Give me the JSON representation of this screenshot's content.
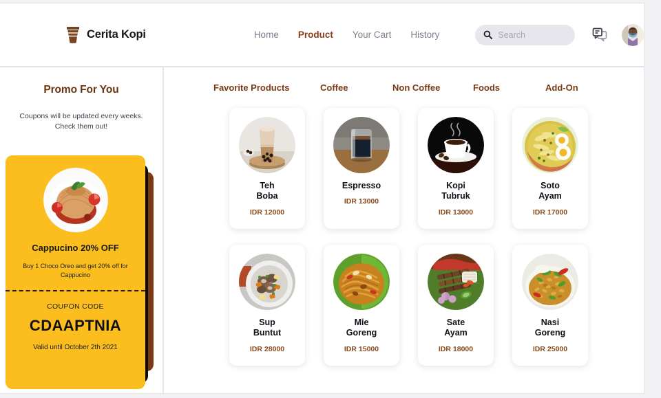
{
  "brand": {
    "name": "Cerita Kopi",
    "logo_icon": "coffee-cup-icon",
    "logo_color": "#7b4420"
  },
  "nav": {
    "items": [
      {
        "label": "Home",
        "active": false
      },
      {
        "label": "Product",
        "active": true
      },
      {
        "label": "Your Cart",
        "active": false
      },
      {
        "label": "History",
        "active": false
      }
    ],
    "active_color": "#8a3c16",
    "inactive_color": "#7d7f8c"
  },
  "search": {
    "placeholder": "Search",
    "value": "",
    "icon": "search-icon"
  },
  "header_actions": {
    "chat_icon": "chat-bubbles-icon",
    "avatar_icon": "user-avatar"
  },
  "sidebar": {
    "title": "Promo For You",
    "subtitle": "Coupons will be updated every weeks.\nCheck them out!",
    "coupon": {
      "photo_icon": "pasta-photo",
      "heading": "Cappucino\n20% OFF",
      "description": "Buy 1 Choco Oreo and get 20%\noff for Cappucino",
      "code_label": "COUPON CODE",
      "code": "CDAAPTNIA",
      "valid": "Valid until October 2th 2021",
      "bg_color": "#fbbe1e",
      "stack_colors": [
        "#0b0b0b",
        "#7c3a12"
      ]
    }
  },
  "categories": {
    "items": [
      {
        "label": "Favorite Products",
        "active": true
      },
      {
        "label": "Coffee",
        "active": false
      },
      {
        "label": "Non Coffee",
        "active": false
      },
      {
        "label": "Foods",
        "active": false
      },
      {
        "label": "Add-On",
        "active": false
      }
    ],
    "color": "#7b3a15"
  },
  "products": [
    {
      "name": "Teh\nBoba",
      "price": "IDR 12000",
      "photo": "teh-boba-photo"
    },
    {
      "name": "Espresso",
      "price": "IDR 13000",
      "photo": "espresso-photo"
    },
    {
      "name": "Kopi\nTubruk",
      "price": "IDR 13000",
      "photo": "kopi-tubruk-photo"
    },
    {
      "name": "Soto\nAyam",
      "price": "IDR 17000",
      "photo": "soto-ayam-photo"
    },
    {
      "name": "Sup\nBuntut",
      "price": "IDR 28000",
      "photo": "sup-buntut-photo"
    },
    {
      "name": "Mie\nGoreng",
      "price": "IDR 15000",
      "photo": "mie-goreng-photo"
    },
    {
      "name": "Sate\nAyam",
      "price": "IDR 18000",
      "photo": "sate-ayam-photo"
    },
    {
      "name": "Nasi\nGoreng",
      "price": "IDR 25000",
      "photo": "nasi-goreng-photo"
    }
  ]
}
